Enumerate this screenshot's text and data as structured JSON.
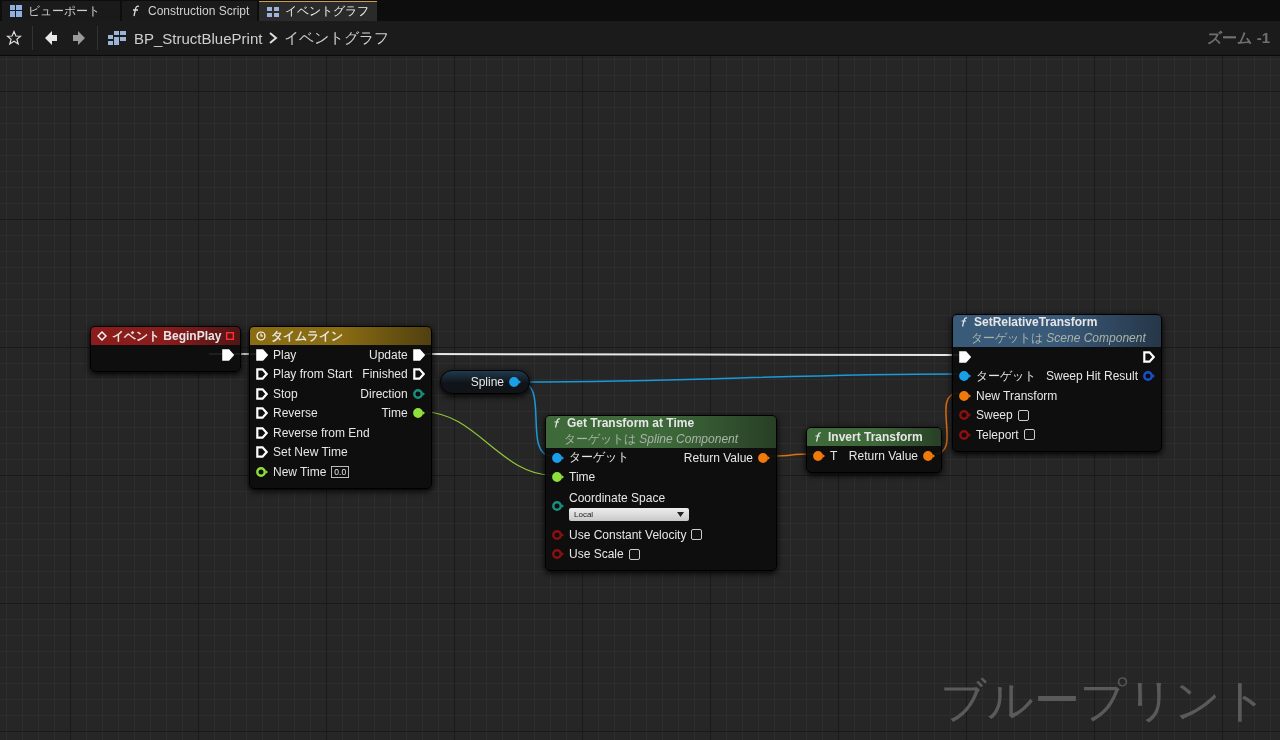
{
  "tabs": [
    {
      "label": "ビューポート",
      "kind": "viewport",
      "selected": false
    },
    {
      "label": "Construction Script",
      "kind": "function",
      "selected": false
    },
    {
      "label": "イベントグラフ",
      "kind": "graph",
      "selected": true
    }
  ],
  "breadcrumb": {
    "blueprint": "BP_StructBluePrint",
    "graph": "イベントグラフ"
  },
  "zoom": "ズーム -1",
  "watermark": "ブループリント",
  "nodes": [
    {
      "kind": "event",
      "title": "イベント BeginPlay",
      "color": "#8a1c1c",
      "outputs": [
        {
          "kind": "exec",
          "color": "#ffffff",
          "connected": true
        }
      ]
    },
    {
      "kind": "timeline",
      "title": "タイムライン",
      "color": "#8a6c12",
      "inputs": [
        {
          "label": "Play",
          "kind": "exec",
          "color": "#ffffff",
          "connected": true
        },
        {
          "label": "Play from Start",
          "kind": "exec",
          "color": "#ffffff",
          "connected": false
        },
        {
          "label": "Stop",
          "kind": "exec",
          "color": "#ffffff",
          "connected": false
        },
        {
          "label": "Reverse",
          "kind": "exec",
          "color": "#ffffff",
          "connected": false
        },
        {
          "label": "Reverse from End",
          "kind": "exec",
          "color": "#ffffff",
          "connected": false
        },
        {
          "label": "Set New Time",
          "kind": "exec",
          "color": "#ffffff",
          "connected": false
        },
        {
          "label": "New Time",
          "kind": "data",
          "color": "#8fe03a",
          "connected": false,
          "control": {
            "kind": "number",
            "value": "0.0"
          }
        }
      ],
      "outputs": [
        {
          "label": "Update",
          "kind": "exec",
          "color": "#ffffff",
          "connected": true
        },
        {
          "label": "Finished",
          "kind": "exec",
          "color": "#ffffff",
          "connected": false
        },
        {
          "label": "Direction",
          "kind": "data",
          "color": "#17907e",
          "connected": false
        },
        {
          "label": "Time",
          "kind": "data",
          "color": "#8fe03a",
          "connected": true
        }
      ]
    },
    {
      "kind": "variable",
      "outputs": [
        {
          "label": "Spline",
          "kind": "data",
          "color": "#1aa0e8",
          "connected": true
        }
      ]
    },
    {
      "kind": "function",
      "title": "Get Transform at Time",
      "subtitle": "ターゲットは *Spline Component*",
      "color": "#3e6a3a",
      "inputs": [
        {
          "label": "ターゲット",
          "kind": "data",
          "color": "#1aa0e8",
          "connected": true
        },
        {
          "label": "Time",
          "kind": "data",
          "color": "#8fe03a",
          "connected": true
        },
        {
          "label": "Coordinate Space",
          "kind": "data",
          "color": "#17907e",
          "connected": false,
          "control": {
            "kind": "dropdown",
            "value": "Local"
          }
        },
        {
          "label": "Use Constant Velocity",
          "kind": "data",
          "color": "#8c1010",
          "connected": false,
          "control": {
            "kind": "checkbox",
            "checked": false
          }
        },
        {
          "label": "Use Scale",
          "kind": "data",
          "color": "#8c1010",
          "connected": false,
          "control": {
            "kind": "checkbox",
            "checked": false
          }
        }
      ],
      "outputs": [
        {
          "label": "Return Value",
          "kind": "data",
          "color": "#f07a0a",
          "connected": true
        }
      ]
    },
    {
      "kind": "function",
      "title": "Invert Transform",
      "color": "#3e6a3a",
      "inputs": [
        {
          "label": "T",
          "kind": "data",
          "color": "#f07a0a",
          "connected": true
        }
      ],
      "outputs": [
        {
          "label": "Return Value",
          "kind": "data",
          "color": "#f07a0a",
          "connected": true
        }
      ]
    },
    {
      "kind": "function",
      "title": "SetRelativeTransform",
      "subtitle": "ターゲットは *Scene Component*",
      "color": "#3a5a7a",
      "inputs": [
        {
          "kind": "exec",
          "color": "#ffffff",
          "connected": true
        },
        {
          "label": "ターゲット",
          "kind": "data",
          "color": "#1aa0e8",
          "connected": true
        },
        {
          "label": "New Transform",
          "kind": "data",
          "color": "#f07a0a",
          "connected": true
        },
        {
          "label": "Sweep",
          "kind": "data",
          "color": "#8c1010",
          "connected": false,
          "control": {
            "kind": "checkbox",
            "checked": false
          }
        },
        {
          "label": "Teleport",
          "kind": "data",
          "color": "#8c1010",
          "connected": false,
          "control": {
            "kind": "checkbox",
            "checked": false
          }
        }
      ],
      "outputs": [
        {
          "kind": "exec",
          "color": "#ffffff",
          "connected": false
        },
        {
          "label": "Sweep Hit Result",
          "kind": "data",
          "color": "#1a50d0",
          "connected": false
        }
      ]
    }
  ]
}
